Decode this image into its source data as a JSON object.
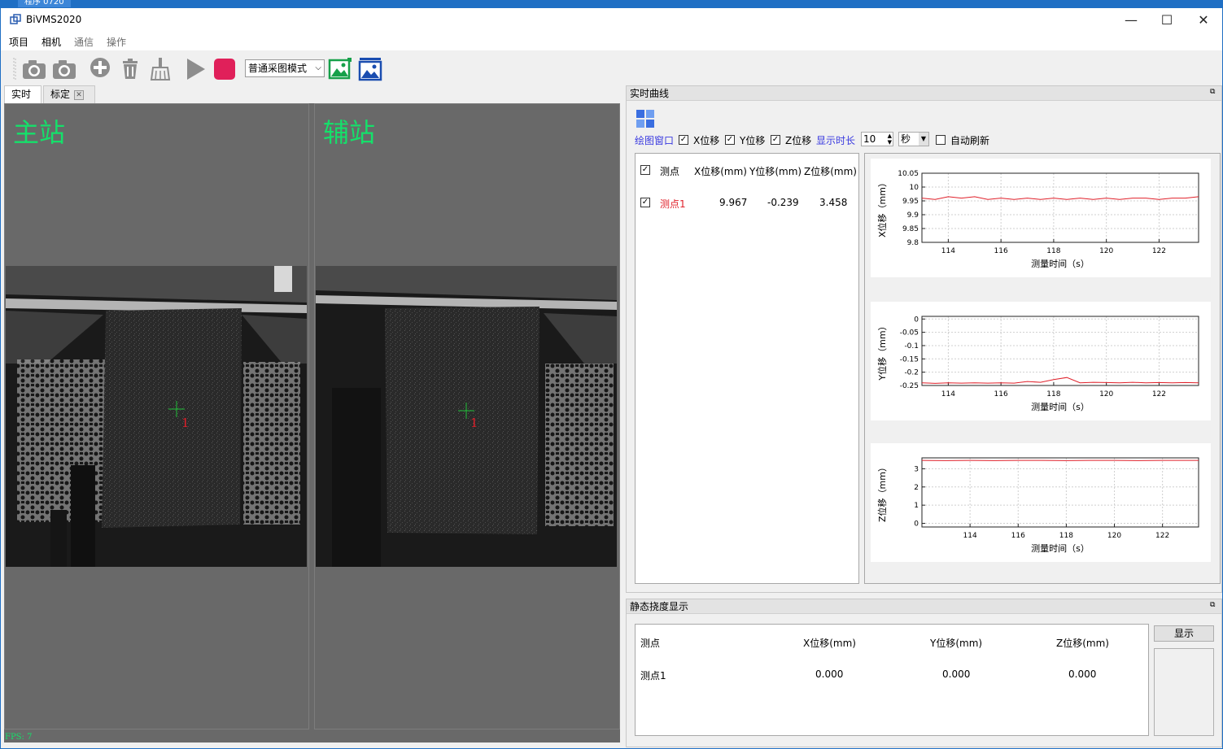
{
  "taskbar_tab": "程序 0720",
  "window": {
    "title": "BiVMS2020",
    "minimize": "—",
    "maximize": "☐",
    "close": "✕"
  },
  "menu": [
    "项目",
    "相机",
    "通信",
    "操作"
  ],
  "toolbar": {
    "mode_value": "普通采图模式"
  },
  "tabs": [
    {
      "label": "实时"
    },
    {
      "label": "标定"
    }
  ],
  "viewer": {
    "main_label": "主站",
    "aux_label": "辅站",
    "fps": "FPS: 7",
    "marker_id": "1"
  },
  "realtime": {
    "title": "实时曲线",
    "plot_window_label": "绘图窗口",
    "x_check": "X位移",
    "y_check": "Y位移",
    "z_check": "Z位移",
    "duration_label": "显示时长",
    "duration_value": "10",
    "duration_unit": "秒",
    "auto_refresh": "自动刷新",
    "list_headers": [
      "测点",
      "X位移(mm)",
      "Y位移(mm)",
      "Z位移(mm)"
    ],
    "list_rows": [
      {
        "name": "测点1",
        "x": "9.967",
        "y": "-0.239",
        "z": "3.458"
      }
    ]
  },
  "static": {
    "title": "静态挠度显示",
    "headers": [
      "测点",
      "X位移(mm)",
      "Y位移(mm)",
      "Z位移(mm)"
    ],
    "rows": [
      {
        "name": "测点1",
        "x": "0.000",
        "y": "0.000",
        "z": "0.000"
      }
    ],
    "show_button": "显示"
  },
  "colors": {
    "accent_green": "#15e06a",
    "series_red": "#e0202a",
    "link_blue": "#3a3ae0"
  },
  "chart_data": [
    {
      "type": "line",
      "ylabel": "X位移（mm）",
      "xlabel": "测量时间（s）",
      "xlim": [
        113,
        123.5
      ],
      "ylim": [
        9.8,
        10.05
      ],
      "grid": true,
      "xticks": [
        114,
        116,
        118,
        120,
        122
      ],
      "yticks": [
        9.8,
        9.85,
        9.9,
        9.95,
        10,
        10.05
      ],
      "ytick_labels": [
        "9.8",
        "9.85",
        "9.9",
        "9.95",
        "10",
        "10.05"
      ],
      "x": [
        113,
        113.5,
        114,
        114.5,
        115,
        115.5,
        116,
        116.5,
        117,
        117.5,
        118,
        118.5,
        119,
        119.5,
        120,
        120.5,
        121,
        121.5,
        122,
        122.5,
        123,
        123.5
      ],
      "y": [
        9.96,
        9.955,
        9.965,
        9.96,
        9.965,
        9.955,
        9.96,
        9.955,
        9.96,
        9.955,
        9.96,
        9.955,
        9.96,
        9.955,
        9.96,
        9.955,
        9.96,
        9.96,
        9.955,
        9.96,
        9.96,
        9.965
      ]
    },
    {
      "type": "line",
      "ylabel": "Y位移（mm）",
      "xlabel": "测量时间（s）",
      "xlim": [
        113,
        123.5
      ],
      "ylim": [
        -0.25,
        0.01
      ],
      "grid": true,
      "xticks": [
        114,
        116,
        118,
        120,
        122
      ],
      "yticks": [
        0,
        -0.05,
        -0.1,
        -0.15,
        -0.2,
        -0.25
      ],
      "ytick_labels": [
        "0",
        "-0.05",
        "-0.1",
        "-0.15",
        "-0.2",
        "-0.25"
      ],
      "x": [
        113,
        113.5,
        114,
        114.5,
        115,
        115.5,
        116,
        116.5,
        117,
        117.5,
        118,
        118.5,
        119,
        119.5,
        120,
        120.5,
        121,
        121.5,
        122,
        122.5,
        123,
        123.5
      ],
      "y": [
        -0.24,
        -0.242,
        -0.24,
        -0.241,
        -0.24,
        -0.241,
        -0.24,
        -0.241,
        -0.235,
        -0.238,
        -0.228,
        -0.22,
        -0.24,
        -0.238,
        -0.239,
        -0.24,
        -0.238,
        -0.24,
        -0.239,
        -0.24,
        -0.239,
        -0.24
      ]
    },
    {
      "type": "line",
      "ylabel": "Z位移（mm）",
      "xlabel": "测量时间（s）",
      "xlim": [
        112,
        123.5
      ],
      "ylim": [
        -0.2,
        3.6
      ],
      "grid": true,
      "xticks": [
        114,
        116,
        118,
        120,
        122
      ],
      "yticks": [
        0,
        1,
        2,
        3
      ],
      "ytick_labels": [
        "0",
        "1",
        "2",
        "3"
      ],
      "x": [
        112,
        113,
        114,
        115,
        116,
        117,
        118,
        119,
        120,
        121,
        122,
        123,
        123.5
      ],
      "y": [
        3.46,
        3.45,
        3.46,
        3.45,
        3.46,
        3.46,
        3.45,
        3.46,
        3.46,
        3.45,
        3.46,
        3.46,
        3.46
      ]
    }
  ]
}
